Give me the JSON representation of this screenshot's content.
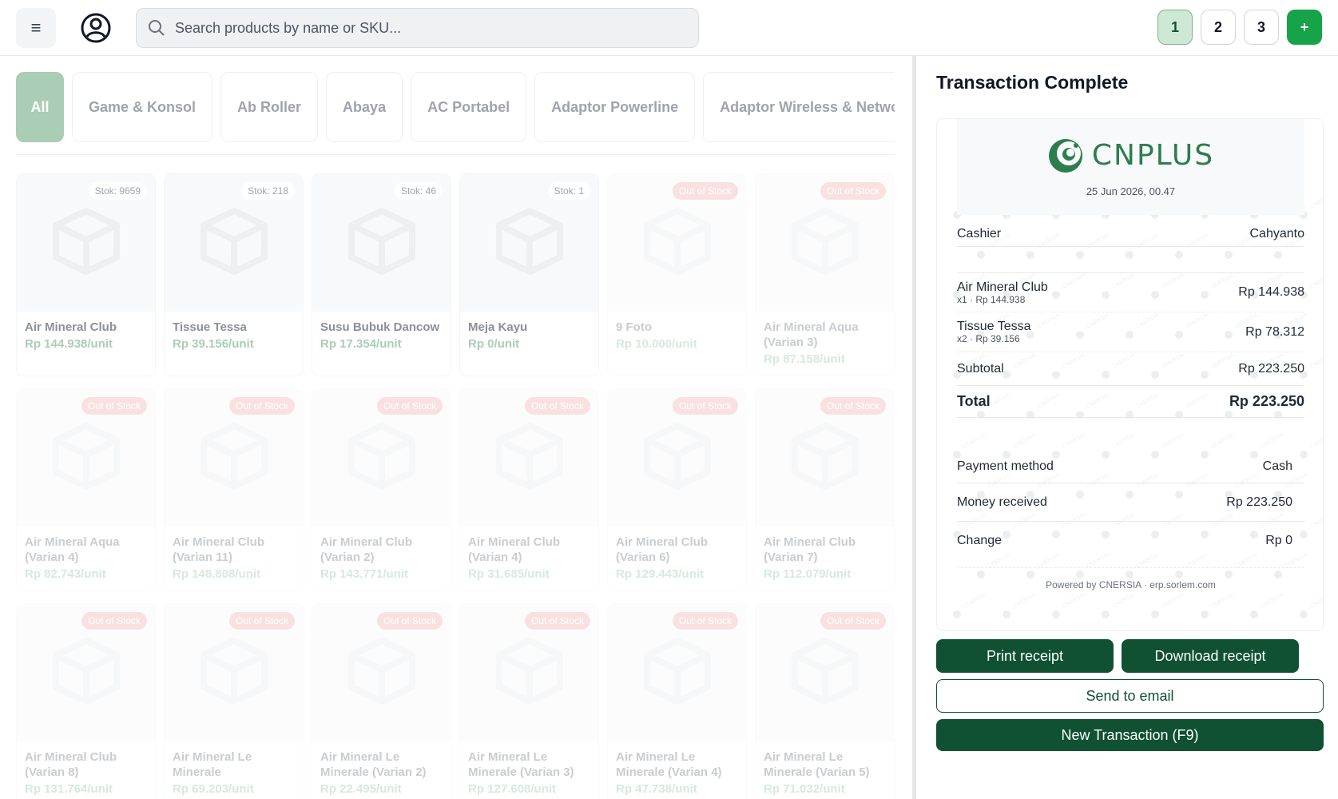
{
  "header": {
    "search_placeholder": "Search products by name or SKU...",
    "sessions": [
      "1",
      "2",
      "3"
    ],
    "add_session_label": "+"
  },
  "categories": [
    "All",
    "Game & Konsol",
    "Ab Roller",
    "Abaya",
    "AC Portabel",
    "Adaptor Powerline",
    "Adaptor Wireless & Networ"
  ],
  "products": [
    {
      "name": "Air Mineral Club",
      "price": "Rp 144.938/unit",
      "badge": "Stok: 9659",
      "oos": false
    },
    {
      "name": "Tissue Tessa",
      "price": "Rp 39.156/unit",
      "badge": "Stok: 218",
      "oos": false
    },
    {
      "name": "Susu Bubuk Dancow",
      "price": "Rp 17.354/unit",
      "badge": "Stok: 46",
      "oos": false
    },
    {
      "name": "Meja Kayu",
      "price": "Rp 0/unit",
      "badge": "Stok: 1",
      "oos": false
    },
    {
      "name": "9 Foto",
      "price": "Rp 10.000/unit",
      "badge": "Out of Stock",
      "oos": true
    },
    {
      "name": "Air Mineral Aqua (Varian 3)",
      "price": "Rp 87.158/unit",
      "badge": "Out of Stock",
      "oos": true
    },
    {
      "name": "Air Mineral Aqua (Varian 4)",
      "price": "Rp 82.743/unit",
      "badge": "Out of Stock",
      "oos": true
    },
    {
      "name": "Air Mineral Club (Varian 11)",
      "price": "Rp 148.808/unit",
      "badge": "Out of Stock",
      "oos": true
    },
    {
      "name": "Air Mineral Club (Varian 2)",
      "price": "Rp 143.771/unit",
      "badge": "Out of Stock",
      "oos": true
    },
    {
      "name": "Air Mineral Club (Varian 4)",
      "price": "Rp 31.685/unit",
      "badge": "Out of Stock",
      "oos": true
    },
    {
      "name": "Air Mineral Club (Varian 6)",
      "price": "Rp 129.443/unit",
      "badge": "Out of Stock",
      "oos": true
    },
    {
      "name": "Air Mineral Club (Varian 7)",
      "price": "Rp 112.079/unit",
      "badge": "Out of Stock",
      "oos": true
    },
    {
      "name": "Air Mineral Club (Varian 8)",
      "price": "Rp 131.764/unit",
      "badge": "Out of Stock",
      "oos": true
    },
    {
      "name": "Air Mineral Le Minerale",
      "price": "Rp 69.203/unit",
      "badge": "Out of Stock",
      "oos": true
    },
    {
      "name": "Air Mineral Le Minerale (Varian 2)",
      "price": "Rp 22.495/unit",
      "badge": "Out of Stock",
      "oos": true
    },
    {
      "name": "Air Mineral Le Minerale (Varian 3)",
      "price": "Rp 127.608/unit",
      "badge": "Out of Stock",
      "oos": true
    },
    {
      "name": "Air Mineral Le Minerale (Varian 4)",
      "price": "Rp 47.738/unit",
      "badge": "Out of Stock",
      "oos": true
    },
    {
      "name": "Air Mineral Le Minerale (Varian 5)",
      "price": "Rp 71.032/unit",
      "badge": "Out of Stock",
      "oos": true
    }
  ],
  "receipt": {
    "title": "Transaction Complete",
    "brand": "CNPLUS",
    "date": "25 Jun 2026, 00.47",
    "cashier_label": "Cashier",
    "cashier_value": "Cahyanto",
    "items": [
      {
        "name": "Air Mineral Club",
        "sub": "x1 · Rp 144.938",
        "amount": "Rp 144.938"
      },
      {
        "name": "Tissue Tessa",
        "sub": "x2 · Rp 39.156",
        "amount": "Rp 78.312"
      }
    ],
    "subtotal_label": "Subtotal",
    "subtotal_value": "Rp 223.250",
    "total_label": "Total",
    "total_value": "Rp 223.250",
    "payment_label": "Payment method",
    "payment_value": "Cash",
    "received_label": "Money received",
    "received_value": "Rp 223.250",
    "change_label": "Change",
    "change_value": "Rp 0",
    "powered": "Powered by CNERSIA · erp.sorlem.com",
    "watermark": "CNERSIA"
  },
  "actions": {
    "print": "Print receipt",
    "download": "Download receipt",
    "email": "Send to email",
    "new": "New Transaction (F9)"
  },
  "colors": {
    "accent": "#7db38f",
    "brand": "#2e7d4f",
    "dark_button": "#0f5132",
    "oos_badge": "#ef9a9a"
  }
}
